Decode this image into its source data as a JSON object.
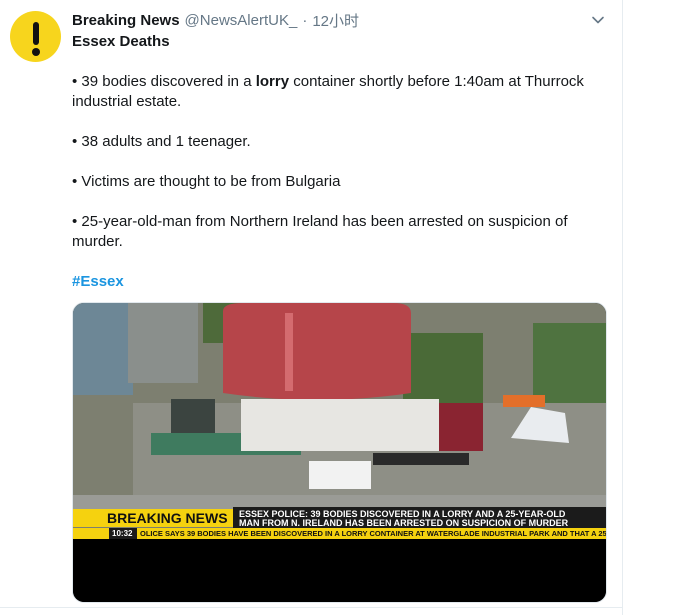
{
  "tweet": {
    "author_name": "Breaking News",
    "handle": "@NewsAlertUK_",
    "separator": "·",
    "time": "12小时",
    "title": "Essex Deaths",
    "bullet1_pre": "• 39 bodies discovered in a ",
    "bullet1_bold": "lorry",
    "bullet1_post": " container shortly before 1:40am at Thurrock industrial estate.",
    "bullet2": "• 38 adults and 1 teenager.",
    "bullet3": "• Victims are thought to be from Bulgaria",
    "bullet4": "• 25-year-old-man from Northern Ireland has been arrested on suspicion of murder.",
    "hashtag": "#Essex"
  },
  "media": {
    "breaking_label": "BREAKING NEWS",
    "headline_line1": "ESSEX POLICE: 39 BODIES DISCOVERED IN A LORRY AND A 25-YEAR-OLD",
    "headline_line2": "MAN FROM N. IRELAND HAS BEEN ARRESTED ON SUSPICION OF MURDER",
    "clock": "10:32",
    "ticker": "OLICE SAYS 39 BODIES HAVE BEEN DISCOVERED IN A LORRY CONTAINER AT WATERGLADE INDUSTRIAL PARK AND THAT A 25-YEA"
  },
  "icons": {
    "avatar": "exclamation-icon",
    "menu": "chevron-down-icon"
  },
  "colors": {
    "avatar_bg": "#f7d51d",
    "hashtag": "#1b95e0",
    "muted": "#657786",
    "breaking_yellow": "#f5d20f",
    "sky_red": "#d7282f",
    "ticker_bar": "#f5d20f"
  }
}
